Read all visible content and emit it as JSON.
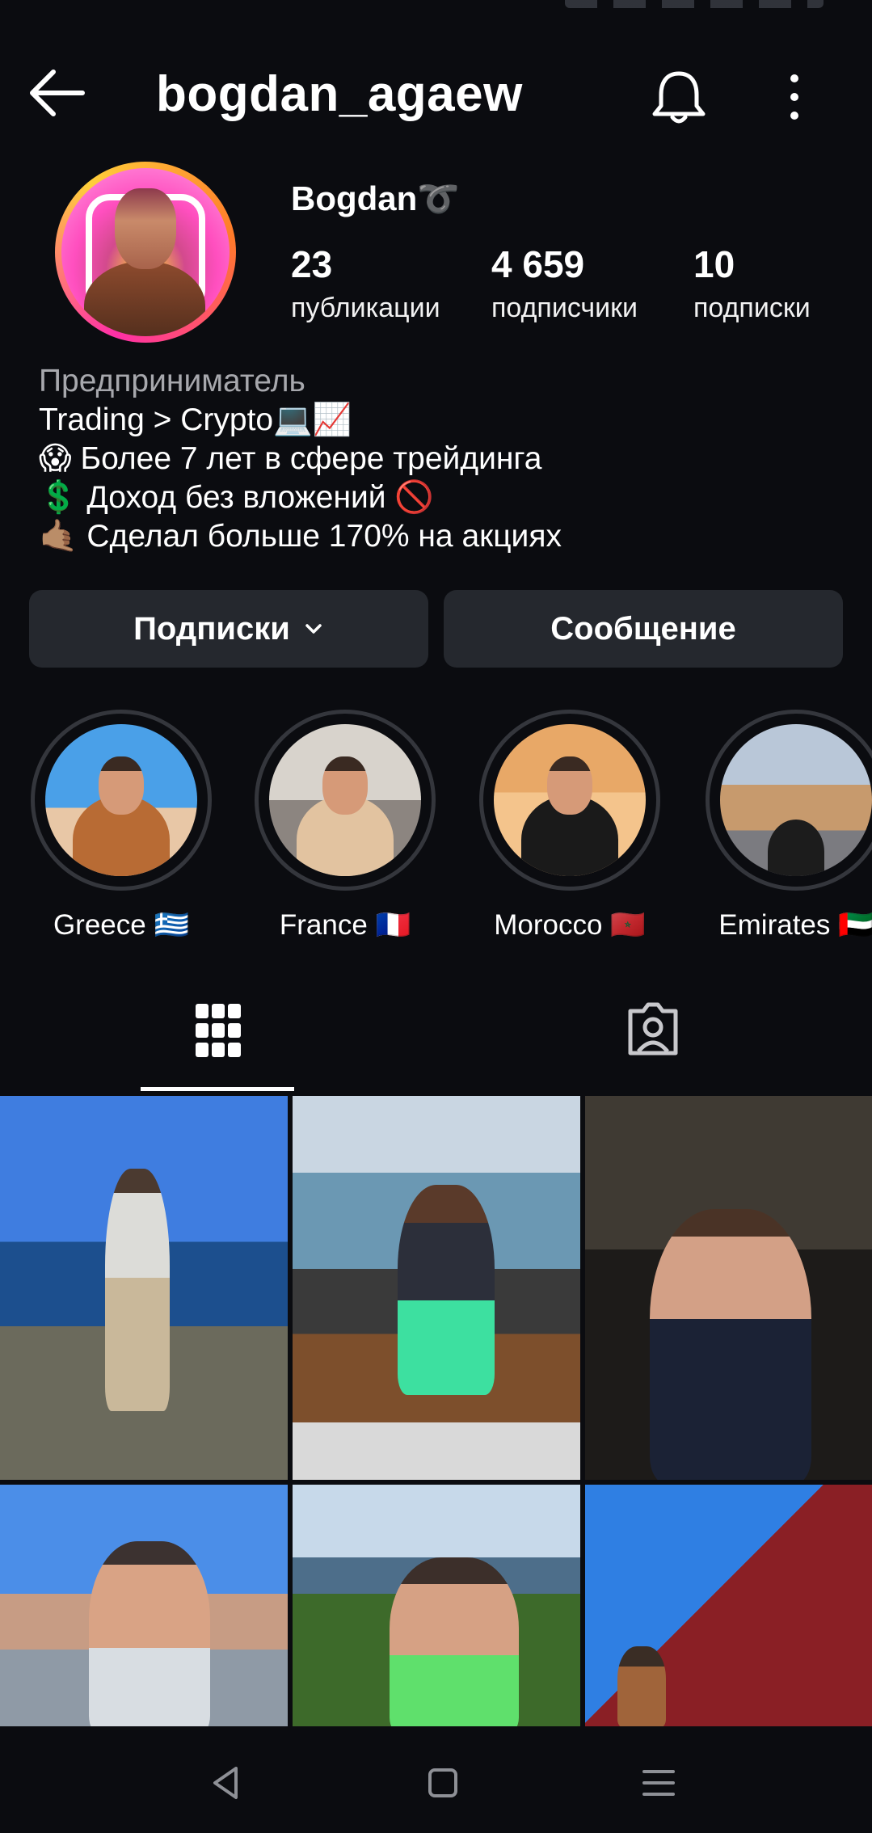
{
  "header": {
    "username": "bogdan_agaew",
    "back_icon": "arrow-left-icon",
    "bell_icon": "bell-icon",
    "more_icon": "more-vertical-icon"
  },
  "profile": {
    "display_name": "Bogdan➰",
    "stats": [
      {
        "value": "23",
        "label": "публикации"
      },
      {
        "value": "4 659",
        "label": "подписчики"
      },
      {
        "value": "10",
        "label": "подписки"
      }
    ],
    "category": "Предприниматель",
    "bio": [
      "Trading > Crypto💻📈",
      "😱 Более 7 лет в сфере трейдинга",
      "💲 Доход без вложений 🚫",
      "🤙🏽 Сделал больше 170% на акциях"
    ]
  },
  "actions": {
    "following_label": "Подписки",
    "message_label": "Сообщение"
  },
  "highlights": [
    {
      "label": "Greece 🇬🇷"
    },
    {
      "label": "France 🇫🇷"
    },
    {
      "label": "Morocco 🇲🇦"
    },
    {
      "label": "Emirates 🇦🇪"
    }
  ],
  "tabs": [
    {
      "icon": "grid-icon",
      "active": true
    },
    {
      "icon": "tagged-person-icon",
      "active": false
    }
  ],
  "nav": {
    "back_icon": "nav-back-triangle-icon",
    "home_icon": "nav-home-square-icon",
    "menu_icon": "nav-menu-lines-icon"
  },
  "colors": {
    "background": "#0b0c10",
    "button": "#25282e",
    "secondary_text": "#a7a8ad"
  }
}
